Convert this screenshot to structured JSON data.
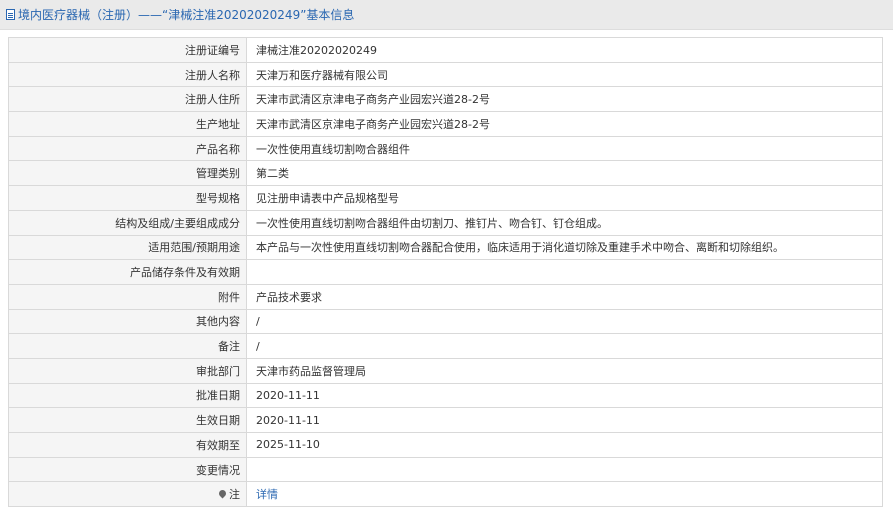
{
  "header": {
    "icon": "document-icon",
    "title": "境内医疗器械（注册）——“津械注准20202020249”基本信息"
  },
  "rows": [
    {
      "label": "注册证编号",
      "value": "津械注准20202020249"
    },
    {
      "label": "注册人名称",
      "value": "天津万和医疗器械有限公司"
    },
    {
      "label": "注册人住所",
      "value": "天津市武清区京津电子商务产业园宏兴道28-2号"
    },
    {
      "label": "生产地址",
      "value": "天津市武清区京津电子商务产业园宏兴道28-2号"
    },
    {
      "label": "产品名称",
      "value": "一次性使用直线切割吻合器组件"
    },
    {
      "label": "管理类别",
      "value": "第二类"
    },
    {
      "label": "型号规格",
      "value": "见注册申请表中产品规格型号"
    },
    {
      "label": "结构及组成/主要组成成分",
      "value": "一次性使用直线切割吻合器组件由切割刀、推钉片、吻合钉、钉仓组成。"
    },
    {
      "label": "适用范围/预期用途",
      "value": "本产品与一次性使用直线切割吻合器配合使用，临床适用于消化道切除及重建手术中吻合、离断和切除组织。"
    },
    {
      "label": "产品储存条件及有效期",
      "value": ""
    },
    {
      "label": "附件",
      "value": "产品技术要求"
    },
    {
      "label": "其他内容",
      "value": "/"
    },
    {
      "label": "备注",
      "value": "/"
    },
    {
      "label": "审批部门",
      "value": "天津市药品监督管理局"
    },
    {
      "label": "批准日期",
      "value": "2020-11-11"
    },
    {
      "label": "生效日期",
      "value": "2020-11-11"
    },
    {
      "label": "有效期至",
      "value": "2025-11-10"
    },
    {
      "label": "变更情况",
      "value": ""
    }
  ],
  "note": {
    "icon": "pin-icon",
    "label": "注",
    "link": "详情"
  }
}
